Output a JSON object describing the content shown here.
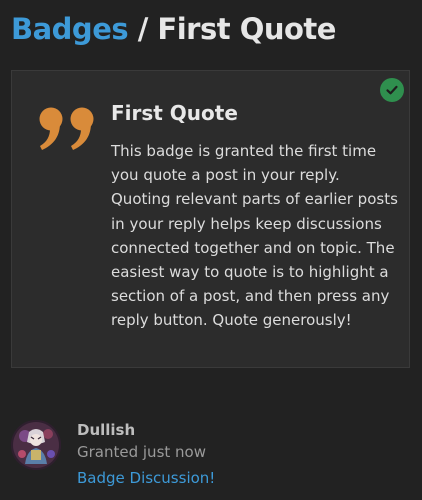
{
  "header": {
    "breadcrumb_link": "Badges",
    "separator": " / ",
    "current": "First Quote"
  },
  "badge": {
    "title": "First Quote",
    "description": "This badge is granted the first time you quote a post in your reply. Quoting relevant parts of earlier posts in your reply helps keep discussions connected together and on topic. The easiest way to quote is to highlight a section of a post, and then press any reply button. Quote generously!",
    "icon": "quote-icon",
    "icon_color": "#d98b3a",
    "granted": true,
    "granted_icon": "check-icon",
    "granted_color": "#2f8f4e"
  },
  "recipient": {
    "username": "Dullish",
    "granted_text": "Granted just now",
    "link_text": "Badge Discussion!",
    "avatar_icon": "user-avatar"
  },
  "colors": {
    "background": "#222222",
    "card": "#2c2c2c",
    "link": "#3d9ad8"
  }
}
